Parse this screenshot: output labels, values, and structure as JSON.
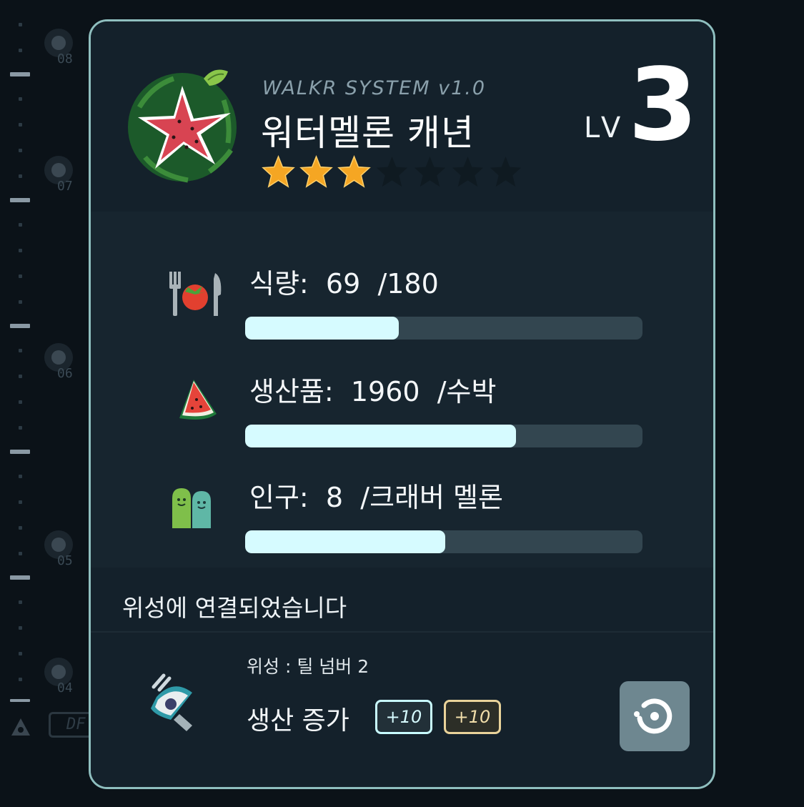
{
  "rail": {
    "labels": [
      "08",
      "07",
      "06",
      "05",
      "04"
    ],
    "df_label": "DF"
  },
  "card": {
    "system_name": "WALKR SYSTEM v1.0",
    "planet_name": "워터멜론 캐년",
    "stars_filled": 3,
    "stars_total": 7,
    "level_label": "LV",
    "level_value": "3",
    "colors": {
      "accent_bar": "#d6fbff",
      "star_filled": "#f5a623",
      "border": "#8fbfbf"
    }
  },
  "stats": [
    {
      "label": "식량:",
      "value": "69",
      "unit": "/180",
      "fill_percent": 38.6,
      "icon": "food-icon"
    },
    {
      "label": "생산품:",
      "value": "1960",
      "unit": "/수박",
      "fill_percent": 68.2,
      "icon": "watermelon-slice-icon"
    },
    {
      "label": "인구:",
      "value": "8",
      "unit": "/크래버 멜론",
      "fill_percent": 50.4,
      "icon": "population-icon"
    }
  ],
  "connection": {
    "text": "위성에 연결되었습니다"
  },
  "satellite": {
    "label": "위성 : 틸 넘버 2",
    "boost_label": "생산 증가",
    "badge_a": "+10",
    "badge_b": "+10",
    "icon": "satellite-icon",
    "button_icon": "target-icon"
  }
}
